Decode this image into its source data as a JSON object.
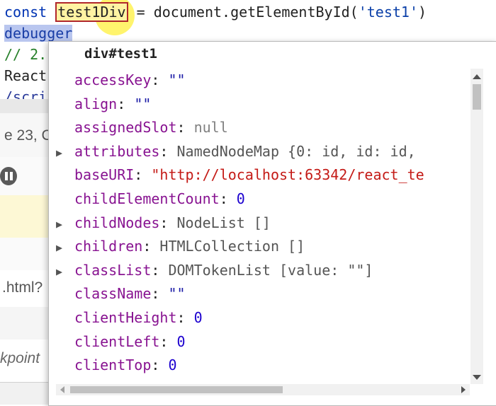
{
  "editor": {
    "line1": {
      "kw": "const",
      "var": "test1Div",
      "mid": " = document.getElementById(",
      "arg": "'test1'",
      "end": ")"
    },
    "line2": {
      "text": "debugger"
    },
    "line3": {
      "text": "// 2."
    },
    "line4": {
      "text": "React"
    },
    "line5": {
      "text": "/scri"
    }
  },
  "panel": {
    "call_text": "e 23, Co",
    "url_text": ".html?",
    "bp_text": "kpoint"
  },
  "popup": {
    "title": "div#test1",
    "properties": [
      {
        "expandable": false,
        "name": "accessKey",
        "value": "\"\"",
        "kind": "str"
      },
      {
        "expandable": false,
        "name": "align",
        "value": "\"\"",
        "kind": "str"
      },
      {
        "expandable": false,
        "name": "assignedSlot",
        "value": "null",
        "kind": "null"
      },
      {
        "expandable": true,
        "name": "attributes",
        "value": "NamedNodeMap {0: id, id: id,",
        "kind": "obj"
      },
      {
        "expandable": false,
        "name": "baseURI",
        "value": "\"http://localhost:63342/react_te",
        "kind": "url"
      },
      {
        "expandable": false,
        "name": "childElementCount",
        "value": "0",
        "kind": "num"
      },
      {
        "expandable": true,
        "name": "childNodes",
        "value": "NodeList []",
        "kind": "obj"
      },
      {
        "expandable": true,
        "name": "children",
        "value": "HTMLCollection []",
        "kind": "obj"
      },
      {
        "expandable": true,
        "name": "classList",
        "value": "DOMTokenList [value: \"\"]",
        "kind": "obj"
      },
      {
        "expandable": false,
        "name": "className",
        "value": "\"\"",
        "kind": "str"
      },
      {
        "expandable": false,
        "name": "clientHeight",
        "value": "0",
        "kind": "num"
      },
      {
        "expandable": false,
        "name": "clientLeft",
        "value": "0",
        "kind": "num"
      },
      {
        "expandable": false,
        "name": "clientTop",
        "value": "0",
        "kind": "num"
      }
    ]
  }
}
